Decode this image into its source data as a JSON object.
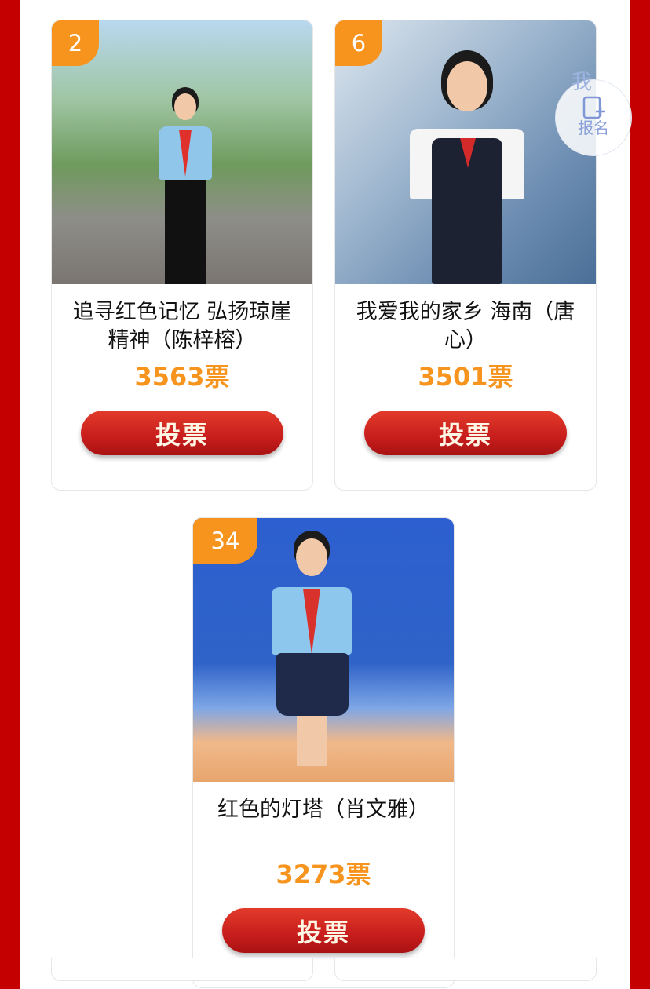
{
  "cards": [
    {
      "rank": "2",
      "title": "追寻红色记忆 弘扬琼崖精神（陈梓榕）",
      "votes": "3563票",
      "vote_label": "投票"
    },
    {
      "rank": "6",
      "title": "我爱我的家乡 海南（唐心）",
      "votes": "3501票",
      "vote_label": "投票"
    },
    {
      "rank": "34",
      "title": "红色的灯塔（肖文雅）",
      "votes": "3273票",
      "vote_label": "投票"
    }
  ],
  "float_button": {
    "top_char": "我",
    "label": "报名",
    "icon": "register-doc-icon"
  },
  "colors": {
    "accent": "#f7941d",
    "button": "#c81d1d",
    "border": "#c40000"
  }
}
